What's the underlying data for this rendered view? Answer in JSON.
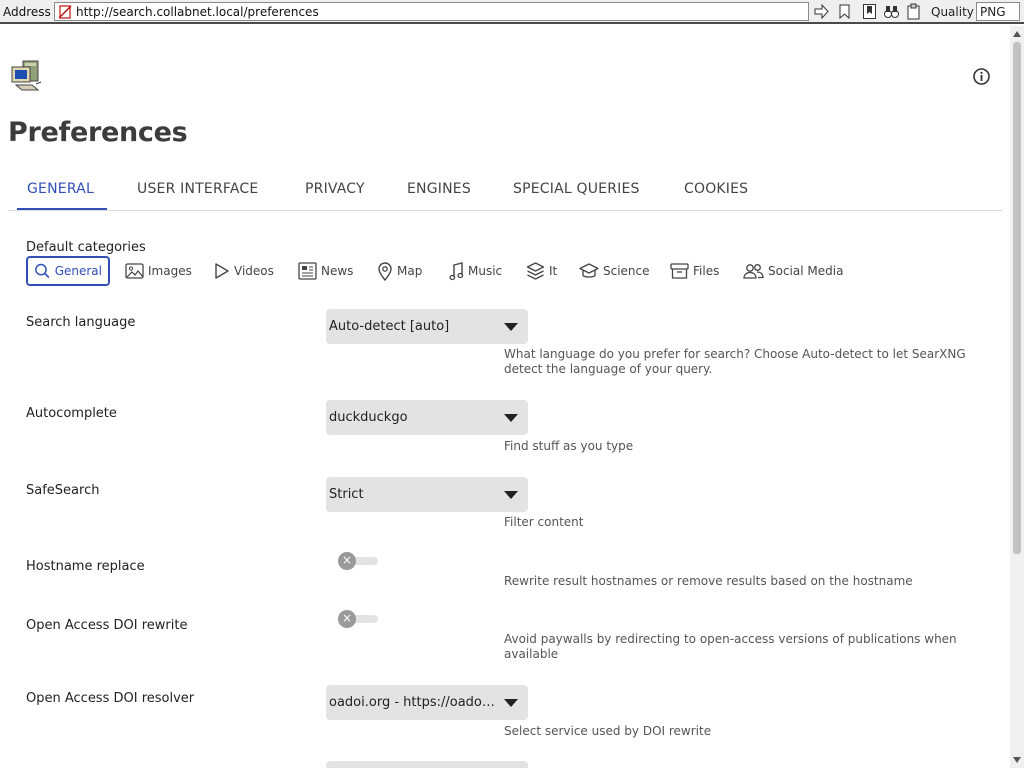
{
  "browser": {
    "address_label": "Address",
    "url": "http://search.collabnet.local/preferences",
    "quality_label": "Quality",
    "quality_value": "PNG"
  },
  "page": {
    "title": "Preferences"
  },
  "tabs": [
    {
      "label": "GENERAL",
      "active": true
    },
    {
      "label": "USER INTERFACE"
    },
    {
      "label": "PRIVACY"
    },
    {
      "label": "ENGINES"
    },
    {
      "label": "SPECIAL QUERIES"
    },
    {
      "label": "COOKIES"
    }
  ],
  "categories": {
    "label": "Default categories",
    "items": [
      {
        "label": "General",
        "icon": "search-icon",
        "selected": true
      },
      {
        "label": "Images",
        "icon": "image-icon"
      },
      {
        "label": "Videos",
        "icon": "play-icon"
      },
      {
        "label": "News",
        "icon": "newspaper-icon"
      },
      {
        "label": "Map",
        "icon": "map-pin-icon"
      },
      {
        "label": "Music",
        "icon": "music-note-icon"
      },
      {
        "label": "It",
        "icon": "layers-icon"
      },
      {
        "label": "Science",
        "icon": "graduation-cap-icon"
      },
      {
        "label": "Files",
        "icon": "archive-icon"
      },
      {
        "label": "Social Media",
        "icon": "people-icon"
      }
    ]
  },
  "settings": {
    "search_language": {
      "label": "Search language",
      "value": "Auto-detect [auto]",
      "description": "What language do you prefer for search? Choose Auto-detect to let SearXNG detect the language of your query."
    },
    "autocomplete": {
      "label": "Autocomplete",
      "value": "duckduckgo",
      "description": "Find stuff as you type"
    },
    "safesearch": {
      "label": "SafeSearch",
      "value": "Strict",
      "description": "Filter content"
    },
    "hostname_replace": {
      "label": "Hostname replace",
      "enabled": false,
      "description": "Rewrite result hostnames or remove results based on the hostname"
    },
    "oa_doi_rewrite": {
      "label": "Open Access DOI rewrite",
      "enabled": false,
      "description": "Avoid paywalls by redirecting to open-access versions of publications when available"
    },
    "oa_doi_resolver": {
      "label": "Open Access DOI resolver",
      "value": "oadoi.org - https://oadoi.org/",
      "description": "Select service used by DOI rewrite"
    }
  },
  "colors": {
    "accent": "#3050b8",
    "select_bg": "#e3e3e3",
    "toggle_off": "#9a9a9a"
  }
}
